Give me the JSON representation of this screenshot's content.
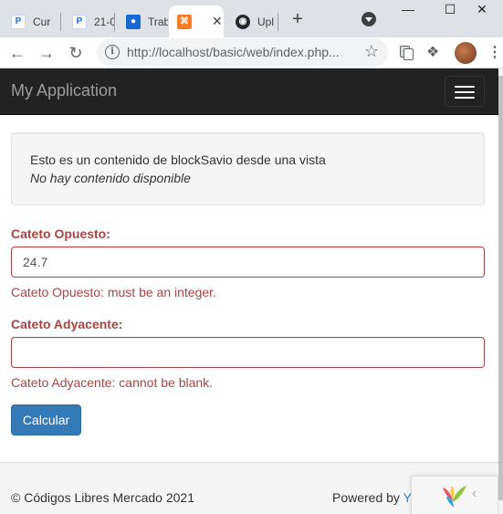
{
  "browser": {
    "tabs": [
      {
        "title": "Cur",
        "favicon": "document-icon",
        "color": "#1a73e8"
      },
      {
        "title": "21-0",
        "favicon": "document-icon",
        "color": "#1a73e8"
      },
      {
        "title": "Trab",
        "favicon": "classroom-icon",
        "color": "#1967d2"
      },
      {
        "title": "",
        "favicon": "xampp-icon",
        "color": "#fb7a24",
        "active": true
      },
      {
        "title": "Upl",
        "favicon": "github-icon",
        "color": "#24292e"
      }
    ],
    "close_glyph": "✕",
    "new_tab_glyph": "+",
    "url": "http://localhost/basic/web/index.php..."
  },
  "app": {
    "brand": "My Application",
    "block": {
      "line1": "Esto es un contenido de blockSavio desde una vista",
      "line2": "No hay contenido disponible"
    },
    "form": {
      "opuesto_label": "Cateto Opuesto:",
      "opuesto_value": "24.7",
      "opuesto_error": "Cateto Opuesto: must be an integer.",
      "adyacente_label": "Cateto Adyacente:",
      "adyacente_value": "",
      "adyacente_error": "Cateto Adyacente: cannot be blank.",
      "submit_label": "Calcular"
    },
    "footer": {
      "copyright": "© Códigos Libres Mercado 2021",
      "powered_prefix": "Powered by ",
      "powered_link": "Y"
    }
  },
  "colors": {
    "error": "#a94442",
    "primary": "#337ab7",
    "navbar": "#222222"
  }
}
